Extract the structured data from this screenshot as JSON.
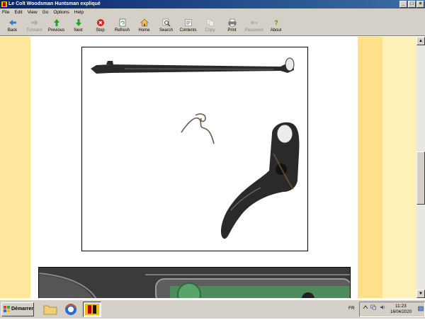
{
  "window": {
    "title": "Le Colt Woodsman Huntsman expliqué",
    "controls": [
      "_",
      "□",
      "×"
    ]
  },
  "menu": [
    "File",
    "Edit",
    "View",
    "Go",
    "Options",
    "Help"
  ],
  "toolbar": {
    "back": "Back",
    "forward": "Forward",
    "previous": "Previous",
    "next": "Next",
    "stop": "Stop",
    "refresh": "Refresh",
    "home": "Home",
    "search": "Search",
    "contents": "Contents",
    "copy": "Copy",
    "print": "Print",
    "password": "Password",
    "about": "About"
  },
  "taskbar": {
    "start_label": "Démarrer",
    "language": "FR",
    "time": "11:23",
    "date": "16/04/2020"
  },
  "scrollbar": {
    "up_arrow": "▲",
    "down_arrow": "▼"
  },
  "colors": {
    "titlebar": "#0a246a",
    "accent_stripe": "#ffe79e",
    "chrome": "#d4d0c8"
  }
}
